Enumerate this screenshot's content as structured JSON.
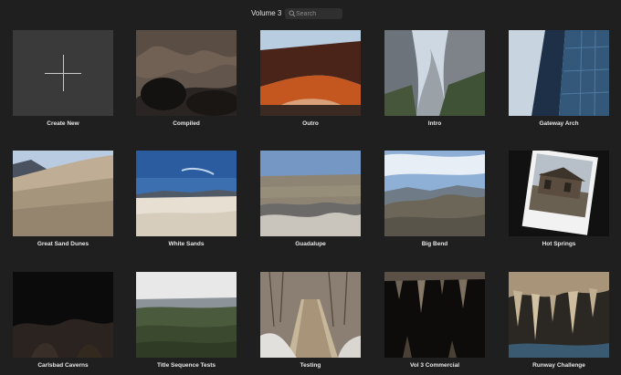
{
  "toolbar": {
    "volume_label": "Volume 3",
    "volume_chevron": "⌃⌄",
    "search_placeholder": "Search",
    "search_value": ""
  },
  "library": {
    "create_new_label": "Create New",
    "projects": [
      {
        "title": "Compiled",
        "thumb": "cave-dark"
      },
      {
        "title": "Outro",
        "thumb": "arch-sunset"
      },
      {
        "title": "Intro",
        "thumb": "canyon-cliffs"
      },
      {
        "title": "Gateway Arch",
        "thumb": "glass-tower"
      },
      {
        "title": "Great Sand Dunes",
        "thumb": "sand-dunes"
      },
      {
        "title": "White Sands",
        "thumb": "white-sands"
      },
      {
        "title": "Guadalupe",
        "thumb": "desert-overlook"
      },
      {
        "title": "Big Bend",
        "thumb": "mountain-valley"
      },
      {
        "title": "Hot Springs",
        "thumb": "polaroid-cabin"
      },
      {
        "title": "Carlsbad Caverns",
        "thumb": "cave-black"
      },
      {
        "title": "Title Sequence Tests",
        "thumb": "forest-vista"
      },
      {
        "title": "Testing",
        "thumb": "boardwalk-trail"
      },
      {
        "title": "Vol 3 Commercial",
        "thumb": "cave-stalactites"
      },
      {
        "title": "Runway Challenge",
        "thumb": "cave-formations"
      }
    ]
  }
}
